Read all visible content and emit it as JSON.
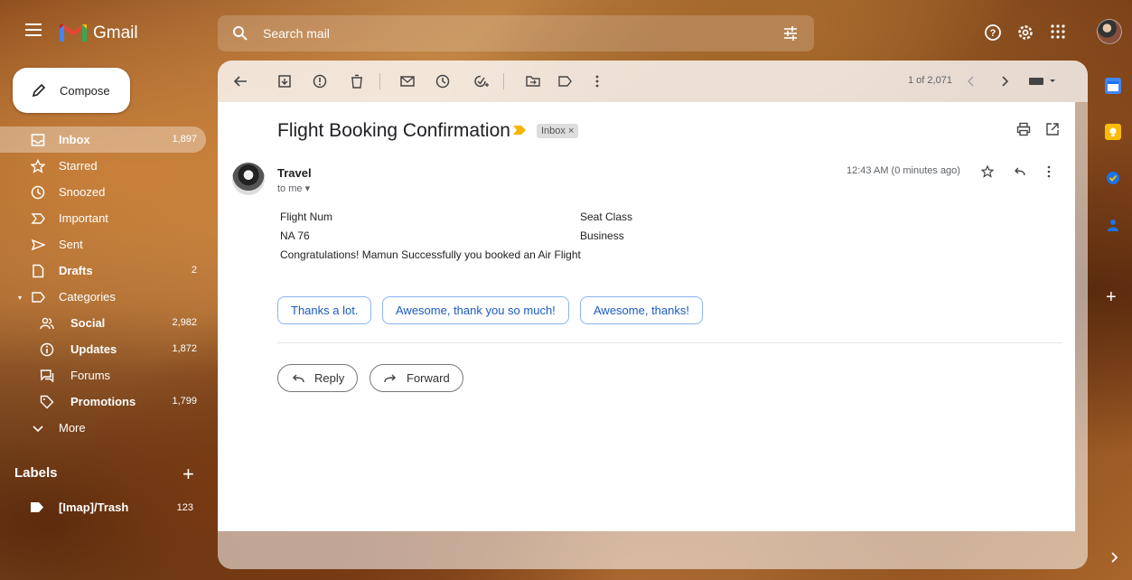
{
  "app": {
    "name": "Gmail"
  },
  "search": {
    "placeholder": "Search mail"
  },
  "compose": {
    "label": "Compose"
  },
  "nav": {
    "items": [
      {
        "label": "Inbox",
        "count": "1,897",
        "icon": "inbox-icon"
      },
      {
        "label": "Starred",
        "count": "",
        "icon": "star-icon"
      },
      {
        "label": "Snoozed",
        "count": "",
        "icon": "clock-icon"
      },
      {
        "label": "Important",
        "count": "",
        "icon": "important-icon"
      },
      {
        "label": "Sent",
        "count": "",
        "icon": "send-icon"
      },
      {
        "label": "Drafts",
        "count": "2",
        "icon": "draft-icon"
      },
      {
        "label": "Categories",
        "count": "",
        "icon": "label-icon"
      }
    ],
    "categories": [
      {
        "label": "Social",
        "count": "2,982",
        "icon": "people-icon"
      },
      {
        "label": "Updates",
        "count": "1,872",
        "icon": "info-icon"
      },
      {
        "label": "Forums",
        "count": "",
        "icon": "forum-icon"
      },
      {
        "label": "Promotions",
        "count": "1,799",
        "icon": "tag-icon"
      }
    ],
    "more": "More"
  },
  "labels": {
    "title": "Labels",
    "items": [
      {
        "label": "[Imap]/Trash",
        "count": "123"
      }
    ]
  },
  "toolbar": {
    "pager": "1 of 2,071"
  },
  "message": {
    "subject": "Flight Booking Confirmation",
    "chip": "Inbox ×",
    "sender": "Travel",
    "to": "to me ▾",
    "time": "12:43 AM (0 minutes ago)",
    "body": {
      "col1_header": "Flight Num",
      "col2_header": "Seat Class",
      "col1_value": "NA 76",
      "col2_value": "Business",
      "line": "Congratulations! Mamun Successfully you booked an Air Flight"
    },
    "smart_replies": [
      "Thanks a lot.",
      "Awesome, thank you so much!",
      "Awesome, thanks!"
    ],
    "reply": "Reply",
    "forward": "Forward"
  },
  "colors": {
    "accent": "#1a5bc4",
    "important": "#f4b400",
    "gmail_red": "#ea4335"
  }
}
